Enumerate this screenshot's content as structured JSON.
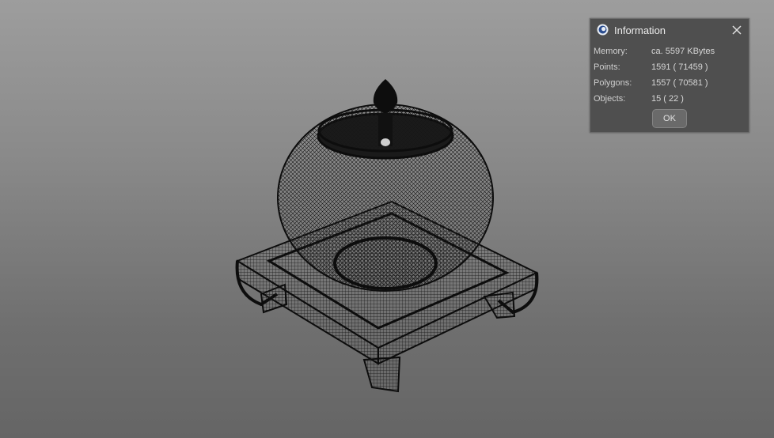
{
  "dialog": {
    "title": "Information",
    "icon": "cinema4d-logo-icon",
    "rows": [
      {
        "label": "Memory:",
        "value": "ca. 5597 KBytes"
      },
      {
        "label": "Points:",
        "value": "1591 ( 71459 )"
      },
      {
        "label": "Polygons:",
        "value": "1557 ( 70581 )"
      },
      {
        "label": "Objects:",
        "value": "15 ( 22 )"
      }
    ],
    "ok_label": "OK"
  },
  "colors": {
    "viewport_top": "#9d9d9d",
    "viewport_bottom": "#656565",
    "dialog_bg": "#4f4f4f",
    "wire": "#111111"
  }
}
